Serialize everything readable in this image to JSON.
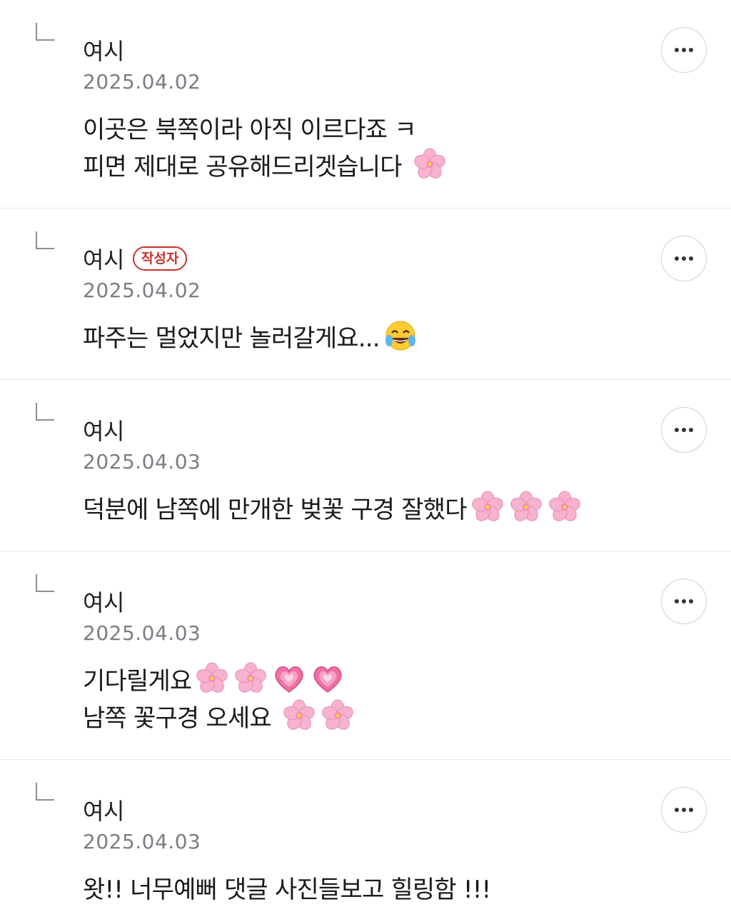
{
  "replies": [
    {
      "author": "여시",
      "date": "2025.04.02",
      "lines": [
        {
          "text": "이곳은 북쪽이라 아직 이르다죠 ㅋ",
          "emojis": []
        },
        {
          "text": "피면 제대로 공유해드리겟습니다 ",
          "emojis": [
            "cherry-blossom"
          ]
        }
      ]
    },
    {
      "author": "여시",
      "badge": "작성자",
      "date": "2025.04.02",
      "lines": [
        {
          "text": "파주는 멀었지만 놀러갈게요...",
          "emojis": [
            "tears-of-joy"
          ]
        }
      ]
    },
    {
      "author": "여시",
      "date": "2025.04.03",
      "lines": [
        {
          "text": "덕분에 남쪽에 만개한 벚꽃 구경 잘했다",
          "emojis": [
            "cherry-blossom",
            "cherry-blossom",
            "cherry-blossom"
          ]
        }
      ]
    },
    {
      "author": "여시",
      "date": "2025.04.03",
      "lines": [
        {
          "text": "기다릴게요",
          "emojis": [
            "cherry-blossom",
            "cherry-blossom",
            "growing-heart",
            "growing-heart"
          ]
        },
        {
          "text": "남쪽 꽃구경 오세요 ",
          "emojis": [
            "cherry-blossom",
            "cherry-blossom"
          ]
        }
      ]
    },
    {
      "author": "여시",
      "date": "2025.04.03",
      "lines": [
        {
          "text": "왓!! 너무예뻐 댓글 사진들보고 힐링함 !!!",
          "emojis": []
        }
      ]
    }
  ],
  "icons": {
    "reply_arrow": "reply-arrow-icon",
    "more": "more-options-icon"
  },
  "colors": {
    "badge": "#c8322e",
    "date": "#7c7c85",
    "divider": "#e6e6e6"
  }
}
